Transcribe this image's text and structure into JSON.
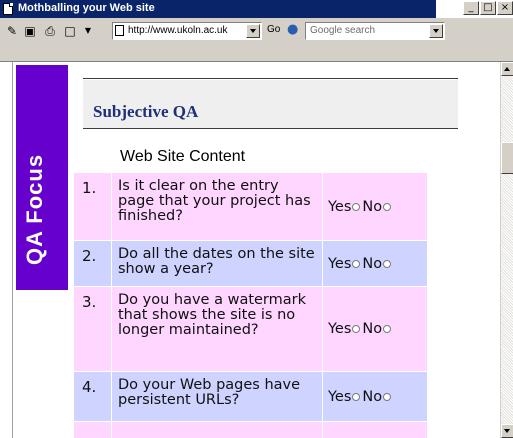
{
  "window": {
    "title": "Mothballing your Web site",
    "controls": {
      "minimize": "_",
      "maximize": "□",
      "close": "×"
    }
  },
  "toolbar": {
    "address": "http://www.ukoln.ac.uk",
    "go_label": "Go",
    "search_placeholder": "Google search",
    "icons": [
      "edit-page-icon",
      "screenshot-icon",
      "print-icon",
      "new-page-icon"
    ]
  },
  "sidebar": {
    "label": "QA Focus",
    "color": "#6600cc"
  },
  "page": {
    "heading": "Subjective QA",
    "section_title": "Web Site Content"
  },
  "questions": [
    {
      "num": "1.",
      "text": "Is it clear on the entry page that your project has finished?",
      "yes": "Yes",
      "no": "No"
    },
    {
      "num": "2.",
      "text": "Do all the dates on the site show a year?",
      "yes": "Yes",
      "no": "No"
    },
    {
      "num": "3.",
      "text": "Do you have a watermark that shows the site is no longer maintained?",
      "yes": "Yes",
      "no": "No"
    },
    {
      "num": "4.",
      "text": "Do your Web pages have persistent URLs?",
      "yes": "Yes",
      "no": "No"
    }
  ],
  "colors": {
    "row_pink": "#ffd6ff",
    "row_lavender": "#cfd3ff",
    "heading": "#1f2f7a"
  }
}
